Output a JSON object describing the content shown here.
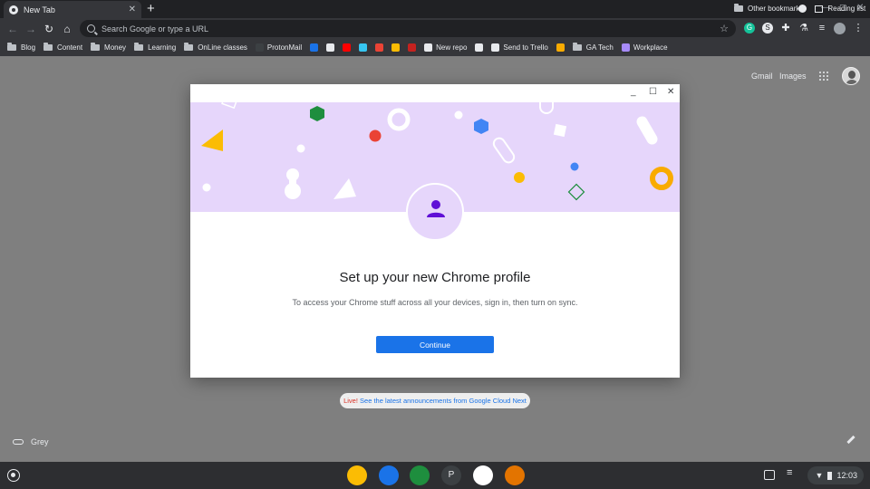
{
  "browser": {
    "tab": {
      "title": "New Tab",
      "close": "✕",
      "favicon": "chrome-icon"
    },
    "new_tab": "+",
    "omnibox": {
      "placeholder": "Search Google or type a URL"
    },
    "nav": {
      "back": "←",
      "forward": "→",
      "reload": "↻",
      "home": "⌂"
    },
    "star": "☆",
    "window_controls": {
      "minimize": "—",
      "maximize": "◻",
      "close": "✕"
    },
    "menu": "⋮"
  },
  "bookmarks": {
    "items": [
      {
        "label": "Blog",
        "kind": "folder"
      },
      {
        "label": "Content",
        "kind": "folder"
      },
      {
        "label": "Money",
        "kind": "folder"
      },
      {
        "label": "Learning",
        "kind": "folder"
      },
      {
        "label": "OnLine classes",
        "kind": "folder"
      },
      {
        "label": "ProtonMail",
        "kind": "site",
        "color": "#3c4043"
      },
      {
        "label": "",
        "kind": "site",
        "color": "#1a73e8"
      },
      {
        "label": "",
        "kind": "site",
        "color": "#e8eaed"
      },
      {
        "label": "",
        "kind": "site",
        "color": "#ff0000"
      },
      {
        "label": "",
        "kind": "site",
        "color": "#36c5f0"
      },
      {
        "label": "",
        "kind": "site",
        "color": "#ea4335"
      },
      {
        "label": "",
        "kind": "site",
        "color": "#fbbc04"
      },
      {
        "label": "",
        "kind": "site",
        "color": "#c5221f"
      },
      {
        "label": "New repo",
        "kind": "site",
        "color": "#e8eaed"
      },
      {
        "label": "",
        "kind": "site",
        "color": "#e8eaed"
      },
      {
        "label": "Send to Trello",
        "kind": "site",
        "color": "#e8eaed"
      },
      {
        "label": "",
        "kind": "site",
        "color": "#f9ab00"
      },
      {
        "label": "GA Tech",
        "kind": "folder"
      },
      {
        "label": "Workplace",
        "kind": "site",
        "color": "#a78bfa"
      }
    ],
    "other": "Other bookmarks",
    "reading_list": "Reading list"
  },
  "ntp": {
    "gmail": "Gmail",
    "images": "Images",
    "announcement_live": "Live!",
    "announcement_text": " See the latest announcements from Google Cloud Next",
    "theme": "Grey"
  },
  "dialog": {
    "heading": "Set up your new Chrome profile",
    "subtext": "To access your Chrome stuff across all your devices, sign in, then turn on sync.",
    "continue_label": "Continue",
    "controls": {
      "minimize": "_",
      "maximize": "☐",
      "close": "✕"
    },
    "colors": {
      "banner": "#e6d6fb",
      "accent": "#1a73e8",
      "person": "#5f0fd6"
    }
  },
  "shelf": {
    "apps": [
      {
        "name": "chrome-app",
        "color": "#fbbc04"
      },
      {
        "name": "files-app",
        "color": "#1a73e8"
      },
      {
        "name": "meet-app",
        "color": "#1e8e3e"
      },
      {
        "name": "p-app",
        "color": "#3c4043",
        "letter": "P"
      },
      {
        "name": "photos-app",
        "color": "#ffffff"
      },
      {
        "name": "cake-app",
        "color": "#e37400"
      }
    ],
    "time": "12:03"
  }
}
